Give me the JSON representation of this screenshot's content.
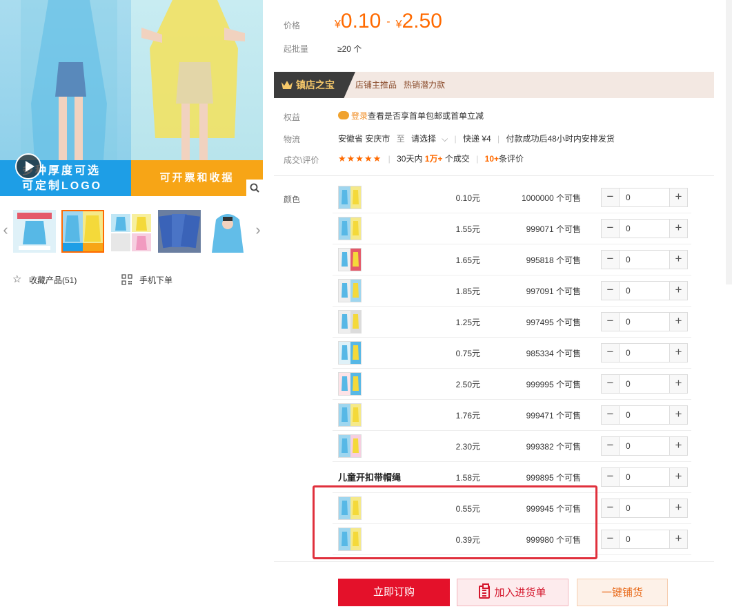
{
  "gallery": {
    "banner_left_line1": "多种厚度可选",
    "banner_left_line2": "可定制LOGO",
    "banner_right": "可开票和收据",
    "play_icon": "play-icon",
    "zoom_icon": "search-icon",
    "thumb_prev_icon": "chevron-left-icon",
    "thumb_next_icon": "chevron-right-icon"
  },
  "actions": {
    "favorite_label": "收藏产品(51)",
    "favorite_icon": "star-outline-icon",
    "mobile_label": "手机下单",
    "mobile_icon": "qr-code-icon"
  },
  "price": {
    "label": "价格",
    "currency": "¥",
    "low": "0.10",
    "dash": "-",
    "high": "2.50"
  },
  "min_order": {
    "label": "起批量",
    "value": "≥20 个"
  },
  "treasure": {
    "badge": "镇店之宝",
    "text": "店铺主推品   热销潜力款",
    "icon": "crown-icon"
  },
  "benefit": {
    "label": "权益",
    "login": "登录",
    "text": "查看是否享首单包邮或首单立减"
  },
  "logistics": {
    "label": "物流",
    "origin": "安徽省 安庆市",
    "to": "至",
    "select": "请选择",
    "express": "快递 ¥4",
    "ship_note": "付款成功后48小时内安排发货"
  },
  "deals": {
    "label": "成交\\评价",
    "rating_stars": "★★★★★",
    "rating": 4.5,
    "days": "30天内",
    "deal_count": "1万+",
    "deal_suffix": "个成交",
    "review_count": "10+",
    "review_suffix": "条评价"
  },
  "sku": {
    "label": "颜色",
    "rows": [
      {
        "price": "0.10元",
        "stock": "1000000 个可售",
        "qty": "0"
      },
      {
        "price": "1.55元",
        "stock": "999071 个可售",
        "qty": "0"
      },
      {
        "price": "1.65元",
        "stock": "995818 个可售",
        "qty": "0"
      },
      {
        "price": "1.85元",
        "stock": "997091 个可售",
        "qty": "0"
      },
      {
        "price": "1.25元",
        "stock": "997495 个可售",
        "qty": "0"
      },
      {
        "price": "0.75元",
        "stock": "985334 个可售",
        "qty": "0"
      },
      {
        "price": "2.50元",
        "stock": "999995 个可售",
        "qty": "0"
      },
      {
        "price": "1.76元",
        "stock": "999471 个可售",
        "qty": "0"
      },
      {
        "price": "2.30元",
        "stock": "999382 个可售",
        "qty": "0"
      },
      {
        "name": "儿童开扣带帽绳",
        "price": "1.58元",
        "stock": "999895 个可售",
        "qty": "0"
      },
      {
        "price": "0.55元",
        "stock": "999945 个可售",
        "qty": "0"
      },
      {
        "price": "0.39元",
        "stock": "999980 个可售",
        "qty": "0"
      }
    ],
    "minus": "−",
    "plus": "+"
  },
  "buttons": {
    "buy": "立即订购",
    "cart": "加入进货单",
    "cart_icon": "clipboard-icon",
    "distribute": "一键铺货"
  }
}
